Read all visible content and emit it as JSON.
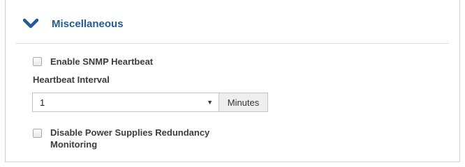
{
  "section": {
    "title": "Miscellaneous",
    "toggle_icon": "chevron-down-icon",
    "accent_color": "#1f5c99"
  },
  "snmp_heartbeat": {
    "label": "Enable SNMP Heartbeat",
    "checked": false
  },
  "heartbeat_interval": {
    "label": "Heartbeat Interval",
    "value": "1",
    "unit": "Minutes"
  },
  "power_supplies": {
    "label_line1": "Disable Power Supplies Redundancy",
    "label_line2": "Monitoring",
    "checked": false
  }
}
